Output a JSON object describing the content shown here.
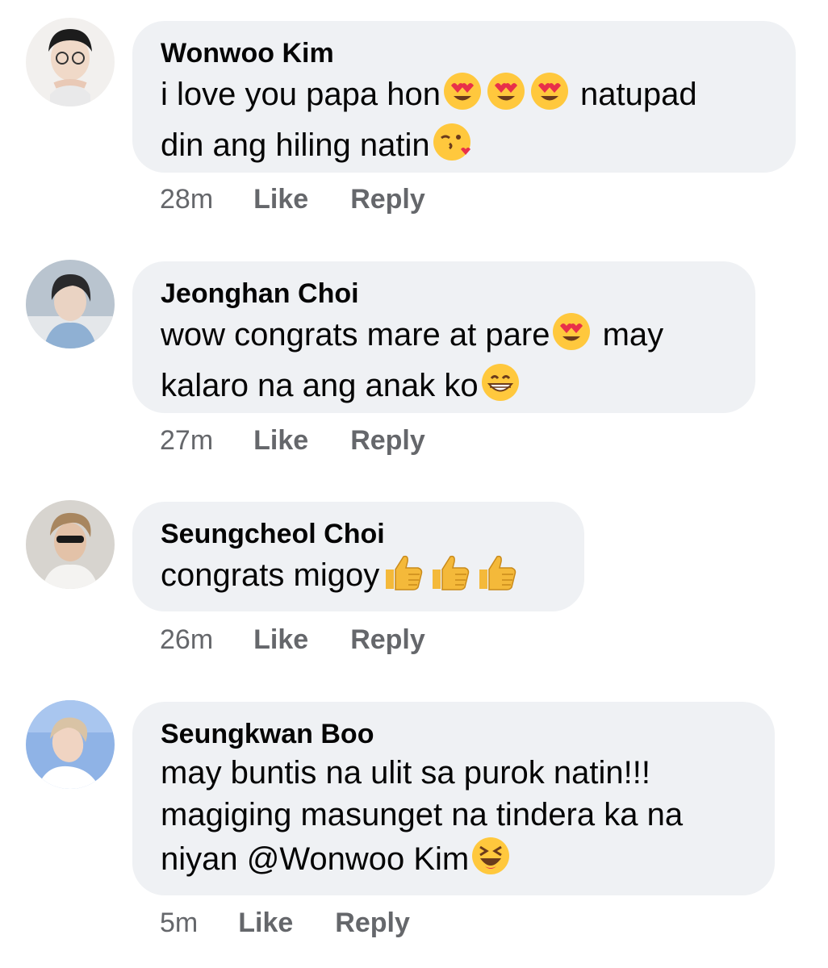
{
  "comments": [
    {
      "author": "Wonwoo Kim",
      "lines": [
        [
          "i love you papa hon",
          "",
          "",
          "",
          " natupad"
        ],
        [
          "din ang hiling natin",
          ""
        ]
      ],
      "emoji_names": [
        "heart-eyes-emoji",
        "heart-eyes-emoji",
        "heart-eyes-emoji",
        "kissing-heart-emoji"
      ],
      "time": "28m",
      "like_label": "Like",
      "reply_label": "Reply"
    },
    {
      "author": "Jeonghan Choi",
      "lines": [
        [
          "wow congrats mare at pare",
          "",
          " may"
        ],
        [
          "kalaro na ang anak ko",
          ""
        ]
      ],
      "emoji_names": [
        "heart-eyes-emoji",
        "grinning-emoji"
      ],
      "time": "27m",
      "like_label": "Like",
      "reply_label": "Reply"
    },
    {
      "author": "Seungcheol Choi",
      "lines": [
        [
          "congrats migoy",
          "",
          "",
          ""
        ]
      ],
      "emoji_names": [
        "thumbs-up-emoji",
        "thumbs-up-emoji",
        "thumbs-up-emoji"
      ],
      "time": "26m",
      "like_label": "Like",
      "reply_label": "Reply"
    },
    {
      "author": "Seungkwan Boo",
      "lines": [
        [
          "may buntis na ulit sa purok natin!!!"
        ],
        [
          "magiging masunget na tindera ka na"
        ],
        [
          "niyan @Wonwoo Kim",
          ""
        ]
      ],
      "emoji_names": [
        "laughing-emoji"
      ],
      "time": "5m",
      "like_label": "Like",
      "reply_label": "Reply"
    }
  ],
  "colors": {
    "bubble_bg": "#eff1f4",
    "text": "#050505",
    "meta": "#65676b",
    "emoji_face": "#ffc83d",
    "heart": "#e8304a",
    "thumb": "#f4b93a"
  }
}
